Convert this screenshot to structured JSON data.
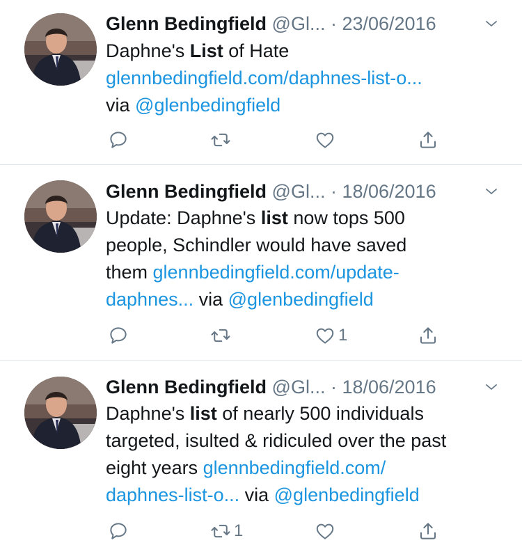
{
  "tweets": [
    {
      "name": "Glenn Bedingfield",
      "handle": "@Gl...",
      "date": "· 23/06/2016",
      "body": [
        [
          {
            "t": "Daphne's ",
            "s": "n"
          },
          {
            "t": "List",
            "s": "b"
          },
          {
            "t": " of Hate",
            "s": "n"
          }
        ],
        [
          {
            "t": "glennbedingfield.com/daphnes-list-o...",
            "s": "l"
          }
        ],
        [
          {
            "t": "via ",
            "s": "n"
          },
          {
            "t": "@glenbedingfield",
            "s": "l"
          }
        ]
      ],
      "reply_count": "",
      "retweet_count": "",
      "like_count": ""
    },
    {
      "name": "Glenn Bedingfield",
      "handle": "@Gl...",
      "date": "· 18/06/2016",
      "body": [
        [
          {
            "t": "Update: Daphne's ",
            "s": "n"
          },
          {
            "t": "list",
            "s": "b"
          },
          {
            "t": " now tops 500",
            "s": "n"
          }
        ],
        [
          {
            "t": "people, Schindler would have saved",
            "s": "n"
          }
        ],
        [
          {
            "t": "them ",
            "s": "n"
          },
          {
            "t": "glennbedingfield.com/update-",
            "s": "l"
          }
        ],
        [
          {
            "t": "daphnes...",
            "s": "l"
          },
          {
            "t": " via ",
            "s": "n"
          },
          {
            "t": "@glenbedingfield",
            "s": "l"
          }
        ]
      ],
      "reply_count": "",
      "retweet_count": "",
      "like_count": "1"
    },
    {
      "name": "Glenn Bedingfield",
      "handle": "@Gl...",
      "date": "· 18/06/2016",
      "body": [
        [
          {
            "t": "Daphne's ",
            "s": "n"
          },
          {
            "t": "list",
            "s": "b"
          },
          {
            "t": " of nearly 500 individuals",
            "s": "n"
          }
        ],
        [
          {
            "t": "targeted, isulted & ridiculed over the past",
            "s": "n"
          }
        ],
        [
          {
            "t": "eight years ",
            "s": "n"
          },
          {
            "t": "glennbedingfield.com/",
            "s": "l"
          }
        ],
        [
          {
            "t": "daphnes-list-o...",
            "s": "l"
          },
          {
            "t": " via ",
            "s": "n"
          },
          {
            "t": "@glenbedingfield",
            "s": "l"
          }
        ]
      ],
      "reply_count": "",
      "retweet_count": "1",
      "like_count": ""
    }
  ],
  "icons": {
    "reply": "reply-icon",
    "retweet": "retweet-icon",
    "like": "heart-icon",
    "share": "share-icon",
    "caret": "chevron-down-icon"
  },
  "colors": {
    "link": "#1b95e0",
    "secondary_text": "#657786",
    "divider": "#e1e8ed"
  }
}
